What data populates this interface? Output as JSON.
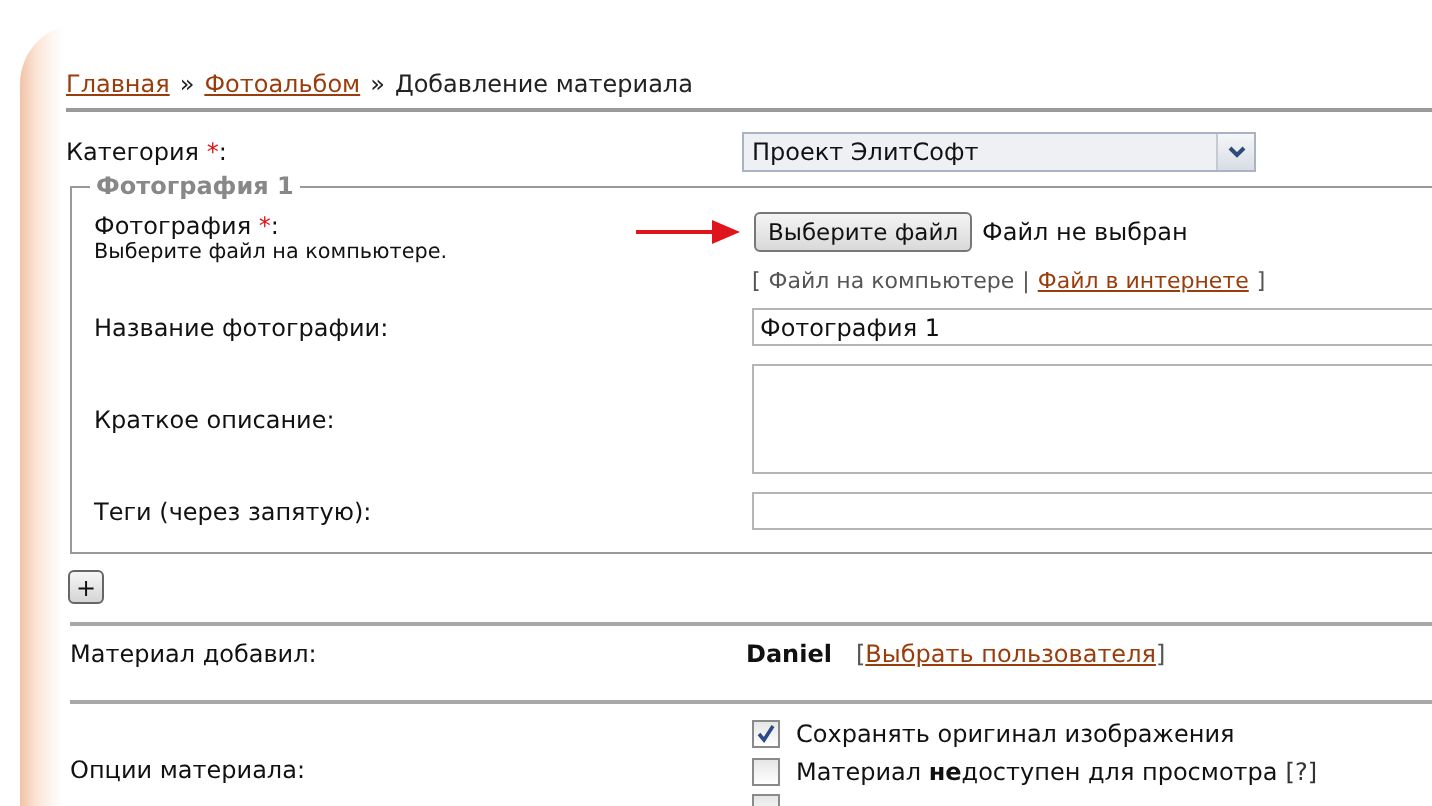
{
  "breadcrumb": {
    "items": [
      {
        "label": "Главная",
        "kind": "link"
      },
      {
        "label": "Фотоальбом",
        "kind": "link"
      },
      {
        "label": "Добавление материала",
        "kind": "current"
      }
    ],
    "separators": [
      "»",
      "»"
    ]
  },
  "category": {
    "label": "Категория",
    "required_mark": "*",
    "suffix": ":",
    "value": "Проект ЭлитСофт"
  },
  "photo_group": {
    "legend": "Фотография 1",
    "file": {
      "label": "Фотография",
      "required_mark": "*",
      "suffix": ":",
      "hint": "Выберите файл на компьютере.",
      "button": "Выберите файл",
      "status": "Файл не выбран",
      "open_bracket": "[",
      "close_bracket": "]",
      "divider": "|",
      "sources": [
        {
          "label": "Файл на компьютере",
          "selected": true
        },
        {
          "label": "Файл в интернете",
          "selected": false
        }
      ]
    },
    "fields": [
      {
        "label": "Название фотографии:",
        "kind": "text",
        "value": "Фотография 1"
      },
      {
        "label": "Краткое описание:",
        "kind": "textarea"
      },
      {
        "label": "Теги (через запятую):",
        "kind": "text"
      }
    ]
  },
  "add_button": "+",
  "author": {
    "label": "Материал добавил:",
    "name": "Daniel",
    "open_bracket": "[",
    "link": "Выбрать пользователя",
    "close_bracket": "]"
  },
  "options": {
    "label": "Опции материала:",
    "items": [
      {
        "kind": "checkbox",
        "label": "Сохранять оригинал изображения",
        "checked": true
      },
      {
        "kind": "checkbox",
        "label": "Материал **не**доступен для просмотра",
        "help": "[?]",
        "checked": false
      },
      {
        "kind": "checkbox",
        "checked": false
      }
    ]
  }
}
